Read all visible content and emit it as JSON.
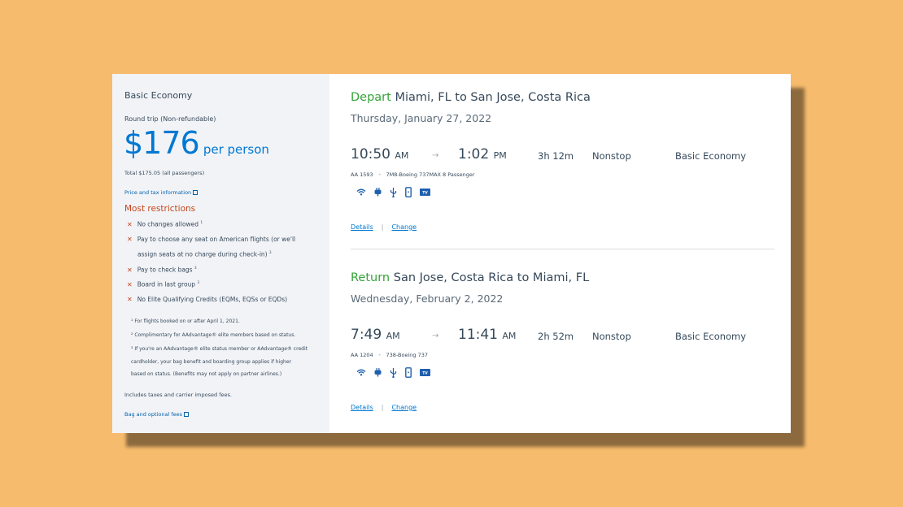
{
  "summary": {
    "fare_title": "Basic Economy",
    "trip_type": "Round trip (Non-refundable)",
    "price": "$176",
    "per_person": "per person",
    "total": "Total $175.05 (all passengers)",
    "price_tax_link": "Price and tax information",
    "restrictions_title": "Most restrictions",
    "restrictions": [
      {
        "text": "No changes allowed",
        "note": "1"
      },
      {
        "text": "Pay to choose any seat on American flights (or we'll",
        "note": ""
      },
      {
        "text": "assign seats at no charge during check-in)",
        "note": "3"
      },
      {
        "text": "Pay to check bags",
        "note": "3"
      },
      {
        "text": "Board in last group",
        "note": "3"
      },
      {
        "text": "No Elite Qualifying Credits (EQMs, EQSs or EQDs)",
        "note": ""
      }
    ],
    "footnotes": [
      "¹ For flights booked on or after April 1, 2021.",
      "² Complimentary for AAdvantage® elite members based on status.",
      "³ If you're an AAdvantage® elite status member or AAdvantage® credit",
      "cardholder, your bag benefit and boarding group applies if higher",
      "based on status. (Benefits may not apply on partner airlines.)"
    ],
    "includes": "Includes taxes and carrier imposed fees.",
    "bag_fees_link": "Bag and optional fees"
  },
  "flights": [
    {
      "direction": "Depart",
      "route": "Miami, FL to San Jose, Costa Rica",
      "date": "Thursday, January 27, 2022",
      "depart_time": "10:50",
      "depart_ampm": "AM",
      "arrive_time": "1:02",
      "arrive_ampm": "PM",
      "duration": "3h  12m",
      "stops": "Nonstop",
      "cabin": "Basic Economy",
      "flight_number": "AA 1593",
      "aircraft": "7M8-Boeing 737MAX 8 Passenger",
      "amenities": [
        "wifi-icon",
        "power-outlet-icon",
        "usb-icon",
        "mobile-device-icon",
        "tv-icon"
      ],
      "details_link": "Details",
      "change_link": "Change"
    },
    {
      "direction": "Return",
      "route": "San Jose, Costa Rica to Miami, FL",
      "date": "Wednesday, February 2, 2022",
      "depart_time": "7:49",
      "depart_ampm": "AM",
      "arrive_time": "11:41",
      "arrive_ampm": "AM",
      "duration": "2h  52m",
      "stops": "Nonstop",
      "cabin": "Basic Economy",
      "flight_number": "AA 1204",
      "aircraft": "738-Boeing 737",
      "amenities": [
        "wifi-icon",
        "power-outlet-icon",
        "usb-icon",
        "mobile-device-icon",
        "tv-icon"
      ],
      "details_link": "Details",
      "change_link": "Change"
    }
  ],
  "labels": {
    "arrow": "→",
    "dot": "•",
    "separator": "|",
    "tv": "TV"
  },
  "colors": {
    "background": "#f6bb6d",
    "accent_blue": "#0078d2",
    "depart_green": "#36a339",
    "restriction_red": "#c3461b"
  }
}
